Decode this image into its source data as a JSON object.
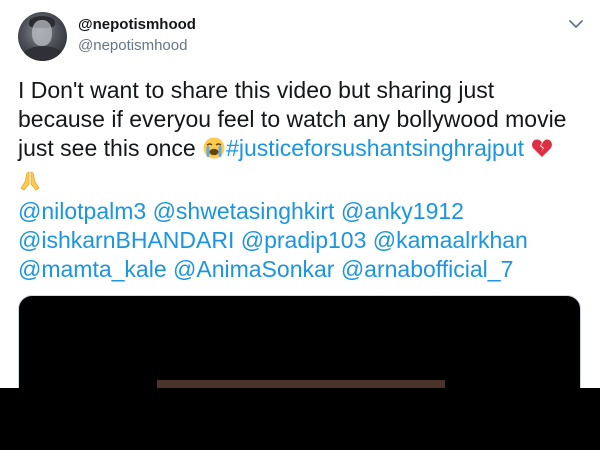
{
  "tweet": {
    "display_name": "@nepotismhood",
    "handle": "@nepotismhood",
    "text_lines": [
      "I Don't want to share this video but sharing just",
      "because if everyou feel to watch any bollywood movie",
      "just see this once"
    ],
    "hashtag": "#justiceforsushantsinghrajput",
    "mention_lines": [
      [
        "@nilotpalm3",
        "@shwetasinghkirt",
        "@anky1912"
      ],
      [
        "@ishkarnBHANDARI",
        "@pradip103",
        "@kamaalrkhan"
      ],
      [
        "@mamta_kale",
        "@AnimaSonkar",
        "@arnabofficial_7"
      ]
    ]
  },
  "icons": {
    "caret": "chevron-down-icon",
    "crying_emoji": "loudly-crying-face-icon",
    "broken_heart_emoji": "broken-heart-icon",
    "folded_hands_emoji": "folded-hands-icon"
  },
  "colors": {
    "link": "#1b95e0",
    "text": "#14171a",
    "secondary": "#657786",
    "media_bg": "#000000"
  }
}
